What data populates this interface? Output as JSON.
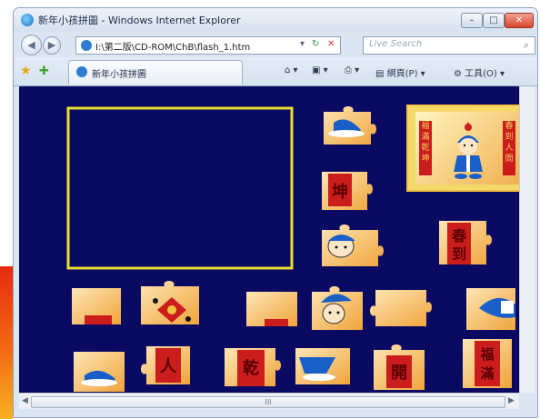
{
  "window": {
    "title": "新年小孩拼圖 - Windows Internet Explorer",
    "minimize_glyph": "–",
    "maximize_glyph": "□",
    "close_glyph": "✕"
  },
  "address_bar": {
    "url": "I:\\第二版\\CD-ROM\\ChB\\flash_1.htm",
    "dropdown_glyph": "▾",
    "refresh_glyph": "↻",
    "stop_glyph": "✕"
  },
  "search": {
    "placeholder": "Live Search",
    "icon": "search-icon"
  },
  "tab": {
    "label": "新年小孩拼圖"
  },
  "command_bar": {
    "page_label": "網頁(P)",
    "tools_label": "工具(O)"
  },
  "puzzle": {
    "characters": [
      "坤",
      "春",
      "到",
      "人",
      "乾",
      "開",
      "福",
      "滿",
      "福"
    ],
    "target_left_couplet": "福滿乾坤",
    "target_right_couplet": "春到人間",
    "colors": {
      "background": "#0a0a62",
      "frame": "#e8e030",
      "piece_light": "#fde6b6",
      "piece_dark": "#f0a43a",
      "couplet_red": "#cc1d1d"
    }
  },
  "scrollbar": {
    "thumb_glyph": "III",
    "left_glyph": "◀",
    "right_glyph": "▶"
  },
  "icons": [
    "back-icon",
    "forward-icon",
    "favorites-star-icon",
    "add-favorites-icon",
    "home-icon",
    "feeds-icon",
    "print-icon",
    "page-icon",
    "tools-icon"
  ]
}
